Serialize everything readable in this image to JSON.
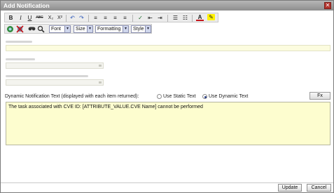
{
  "window": {
    "title": "Add Notification",
    "close_glyph": "✕"
  },
  "toolbar_row1": {
    "bold": "B",
    "italic": "I",
    "underline": "U",
    "strikethrough": "ABC",
    "subscript": "X₂",
    "superscript": "X²",
    "undo": "↶",
    "redo": "↷",
    "align_left": "≡",
    "align_center": "≡",
    "align_right": "≡",
    "align_justify": "≡",
    "spellcheck": "✓",
    "outdent": "⇤",
    "indent": "⇥",
    "bullets": "☰",
    "numbering": "☷",
    "font_color": "A",
    "highlight": "✎"
  },
  "toolbar_row2": {
    "font": "Font",
    "size": "Size",
    "formatting": "Formatting",
    "style": "Style",
    "dropdown_arrow": "▾"
  },
  "dynamic_text": {
    "label": "Dynamic Notification Text (displayed with each item returned):",
    "option_static": "Use Static Text",
    "option_dynamic": "Use Dynamic Text",
    "selected": "Use Dynamic Text",
    "fx_button": "Fx",
    "editor_value": "The task associated with CVE ID: [ATTRIBUTE_VALUE.CVE Name] cannot be performed"
  },
  "footer": {
    "update": "Update",
    "cancel": "Cancel"
  },
  "colors": {
    "accent_close": "#b2332c",
    "editor_bg": "#fdfdcf",
    "titlebar": "#9a9a9a"
  }
}
